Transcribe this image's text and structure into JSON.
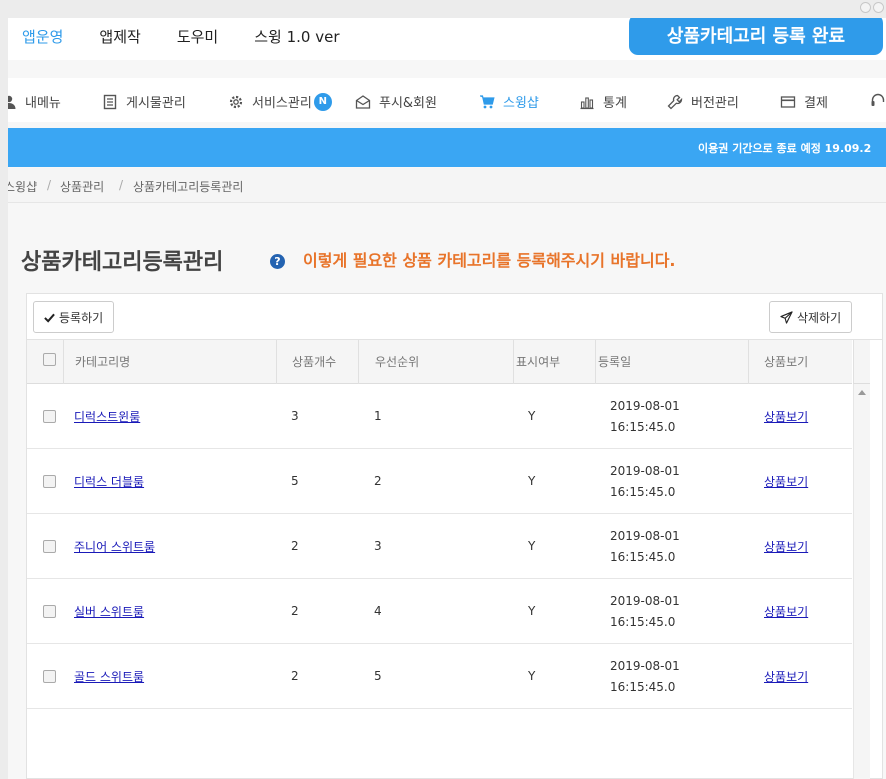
{
  "window": {
    "controls": [
      "minimize",
      "close"
    ]
  },
  "topnav": {
    "items": [
      {
        "label": "앱운영",
        "active": true
      },
      {
        "label": "앱제작",
        "active": false
      },
      {
        "label": "도우미",
        "active": false
      },
      {
        "label": "스윙 1.0 ver",
        "active": false
      }
    ]
  },
  "toast": {
    "text": "상품카테고리 등록 완료"
  },
  "menubar": {
    "items": [
      {
        "label": "내메뉴",
        "icon": "user-icon"
      },
      {
        "label": "게시물관리",
        "icon": "list-icon"
      },
      {
        "label": "서비스관리",
        "icon": "gear-icon",
        "badge": "N"
      },
      {
        "label": "푸시&회원",
        "icon": "envelope-icon"
      },
      {
        "label": "스윙샵",
        "icon": "cart-icon",
        "active": true
      },
      {
        "label": "통계",
        "icon": "bar-chart-icon"
      },
      {
        "label": "버전관리",
        "icon": "wrench-icon"
      },
      {
        "label": "결제",
        "icon": "card-icon"
      }
    ]
  },
  "notice": {
    "text": "이용권 기간으로 종료 예정 19.09.2"
  },
  "breadcrumb": {
    "items": [
      "스윙샵",
      "상품관리",
      "상품카테고리등록관리"
    ],
    "separator": "/"
  },
  "page": {
    "title": "상품카테고리등록관리",
    "help": "?",
    "hint": "이렇게 필요한 상품 카테고리를 등록해주시기 바랍니다."
  },
  "toolbar": {
    "register_label": "등록하기",
    "delete_label": "삭제하기"
  },
  "table": {
    "headers": {
      "name": "카테고리명",
      "count": "상품개수",
      "priority": "우선순위",
      "display": "표시여부",
      "date": "등록일",
      "view": "상품보기"
    },
    "rows": [
      {
        "name": "디럭스트윈룸",
        "count": "3",
        "priority": "1",
        "display": "Y",
        "date": "2019-08-01",
        "time": "16:15:45.0",
        "view": "상품보기"
      },
      {
        "name": "디럭스 더블룸",
        "count": "5",
        "priority": "2",
        "display": "Y",
        "date": "2019-08-01",
        "time": "16:15:45.0",
        "view": "상품보기"
      },
      {
        "name": "주니어 스위트룸",
        "count": "2",
        "priority": "3",
        "display": "Y",
        "date": "2019-08-01",
        "time": "16:15:45.0",
        "view": "상품보기"
      },
      {
        "name": "실버 스위트룸",
        "count": "2",
        "priority": "4",
        "display": "Y",
        "date": "2019-08-01",
        "time": "16:15:45.0",
        "view": "상품보기"
      },
      {
        "name": "골드 스위트룸",
        "count": "2",
        "priority": "5",
        "display": "Y",
        "date": "2019-08-01",
        "time": "16:15:45.0",
        "view": "상품보기"
      }
    ]
  },
  "colors": {
    "accent": "#2f9bea",
    "notice_bar": "#3aa6f3",
    "hint": "#e8742a",
    "link": "#1a1ab8"
  }
}
